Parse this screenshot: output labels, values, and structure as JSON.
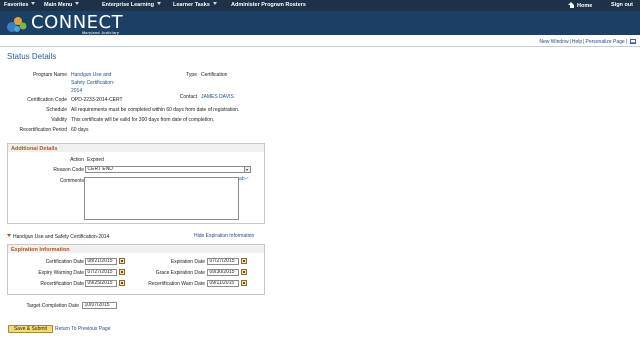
{
  "topnav": {
    "favorites": "Favorites",
    "main_menu": "Main Menu",
    "enterprise_learning": "Enterprise Learning",
    "learner_tasks": "Learner Tasks",
    "current_page": "Administer Program Rosters",
    "home": "Home",
    "sign_out": "Sign out"
  },
  "banner": {
    "logo_text": "CONNECT",
    "logo_sub": "Maryland Judiciary"
  },
  "util_links": {
    "new_window": "New Window",
    "help": "Help",
    "personalize": "Personalize Page"
  },
  "page_title": "Status Details",
  "details": {
    "program_name_label": "Program Name",
    "program_name_line1": "Handgun Use and",
    "program_name_line2": "Safety Certification-",
    "program_name_line3": "2014",
    "type_label": "Type",
    "type_value": "Certification",
    "contact_label": "Contact",
    "contact_value": "JAMES DAVIS",
    "cert_code_label": "Certification Code",
    "cert_code_value": "OPD-2233-2014-CERT",
    "schedule_label": "Schedule",
    "schedule_value": "All requirements must be completed within 60 days from date of registration.",
    "validity_label": "Validity",
    "validity_value": "This certificate will be valid for 300 days from date of completion.",
    "recert_period_label": "Recertification Period",
    "recert_period_value": "60 days"
  },
  "additional": {
    "header": "Additional Details",
    "action_label": "Action",
    "action_value": "Expired",
    "reason_label": "Reason Code",
    "reason_value": "CERT END",
    "comments_label": "Comments",
    "comments_value": ""
  },
  "program_toggle": {
    "title": "Handgun Use and Safety Certification-2014",
    "hide_link": "Hide Expiration Information"
  },
  "expiration": {
    "header": "Expiration Information",
    "cert_date_label": "Certification Date",
    "cert_date_value": "08/21/2015",
    "exp_date_label": "Expiration Date",
    "exp_date_value": "07/27/2015",
    "exp_warn_label": "Expiry Warning Date",
    "exp_warn_value": "07/27/2015",
    "grace_label": "Grace Expiration Date",
    "grace_value": "09/30/2015",
    "recert_date_label": "Recertification Date",
    "recert_date_value": "09/25/2015",
    "recert_warn_label": "Recertification Warn Date",
    "recert_warn_value": "09/11/2015"
  },
  "target": {
    "label": "Target Completion Date",
    "value": "10/07/2015"
  },
  "actions": {
    "save_submit": "Save & Submit",
    "return_link": "Return To Previous Page"
  },
  "colors": {
    "nav_bg": "#1d3248",
    "banner_bg": "#1c3f66",
    "section_header_text": "#b5541d",
    "link": "#1f4e8c",
    "button_bg": "#f6d97a"
  }
}
